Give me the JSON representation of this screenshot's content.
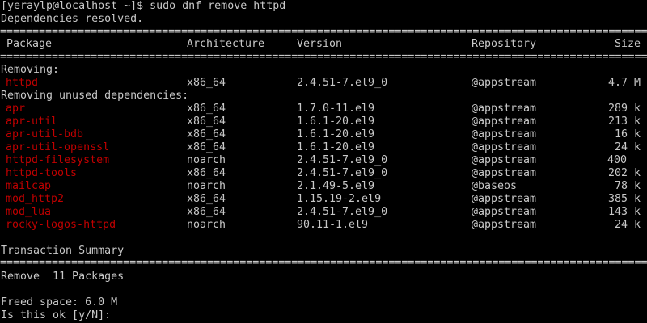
{
  "terminal": {
    "prompt_line": "[yeraylp@localhost ~]$ sudo dnf remove httpd",
    "deps_resolved": "Dependencies resolved.",
    "separator": "================================================================================================================================================",
    "columns": {
      "package": "Package",
      "architecture": "Architecture",
      "version": "Version",
      "repository": "Repository",
      "size": "Size"
    },
    "removing_label": "Removing:",
    "removing": [
      {
        "name": "httpd",
        "arch": "x86_64",
        "version": "2.4.51-7.el9_0",
        "repo": "@appstream",
        "size": "4.7 M"
      }
    ],
    "unused_label": "Removing unused dependencies:",
    "unused": [
      {
        "name": "apr",
        "arch": "x86_64",
        "version": "1.7.0-11.el9",
        "repo": "@appstream",
        "size": "289 k"
      },
      {
        "name": "apr-util",
        "arch": "x86_64",
        "version": "1.6.1-20.el9",
        "repo": "@appstream",
        "size": "213 k"
      },
      {
        "name": "apr-util-bdb",
        "arch": "x86_64",
        "version": "1.6.1-20.el9",
        "repo": "@appstream",
        "size": "16 k"
      },
      {
        "name": "apr-util-openssl",
        "arch": "x86_64",
        "version": "1.6.1-20.el9",
        "repo": "@appstream",
        "size": "24 k"
      },
      {
        "name": "httpd-filesystem",
        "arch": "noarch",
        "version": "2.4.51-7.el9_0",
        "repo": "@appstream",
        "size": "400"
      },
      {
        "name": "httpd-tools",
        "arch": "x86_64",
        "version": "2.4.51-7.el9_0",
        "repo": "@appstream",
        "size": "202 k"
      },
      {
        "name": "mailcap",
        "arch": "noarch",
        "version": "2.1.49-5.el9",
        "repo": "@baseos",
        "size": "78 k"
      },
      {
        "name": "mod_http2",
        "arch": "x86_64",
        "version": "1.15.19-2.el9",
        "repo": "@appstream",
        "size": "385 k"
      },
      {
        "name": "mod_lua",
        "arch": "x86_64",
        "version": "2.4.51-7.el9_0",
        "repo": "@appstream",
        "size": "143 k"
      },
      {
        "name": "rocky-logos-httpd",
        "arch": "noarch",
        "version": "90.11-1.el9",
        "repo": "@appstream",
        "size": "24 k"
      }
    ],
    "summary_label": "Transaction Summary",
    "remove_line": "Remove  11 Packages",
    "freed_space": "Freed space: 6.0 M",
    "confirm_prompt": "Is this ok [y/N]: "
  },
  "colors": {
    "background": "#000000",
    "text": "#c8c8c8",
    "package_name": "#c00000"
  }
}
